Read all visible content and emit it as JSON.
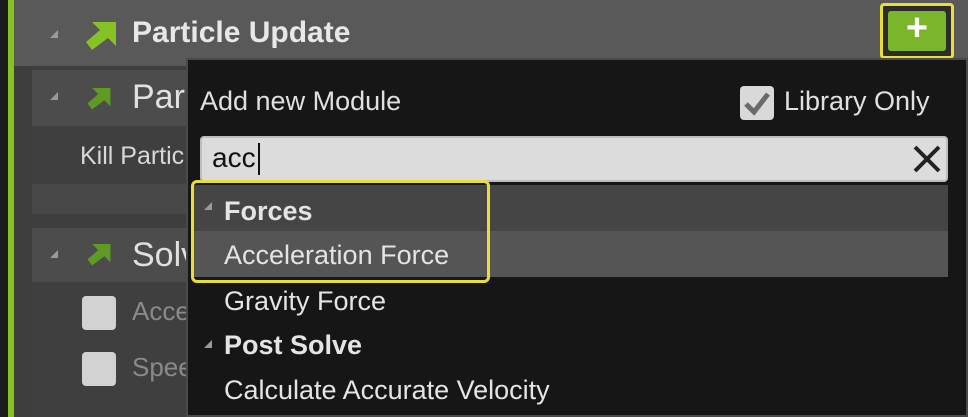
{
  "header": {
    "title": "Particle Update",
    "add_button_label": "+"
  },
  "sections": [
    {
      "label": "Par"
    },
    {
      "label": "Solv"
    }
  ],
  "rows": [
    {
      "label": "Kill Partic"
    },
    {
      "label": "Acce"
    },
    {
      "label": "Spee"
    }
  ],
  "popup": {
    "title": "Add new Module",
    "library_only_label": "Library Only",
    "library_only_checked": true,
    "search_value": "acc",
    "categories": [
      {
        "name": "Forces",
        "items": [
          "Acceleration Force",
          "Gravity Force"
        ]
      },
      {
        "name": "Post Solve",
        "items": [
          "Calculate Accurate Velocity"
        ]
      }
    ],
    "selected_item": "Acceleration Force"
  },
  "colors": {
    "accent_green": "#86c225",
    "highlight_yellow": "#e8de37"
  }
}
